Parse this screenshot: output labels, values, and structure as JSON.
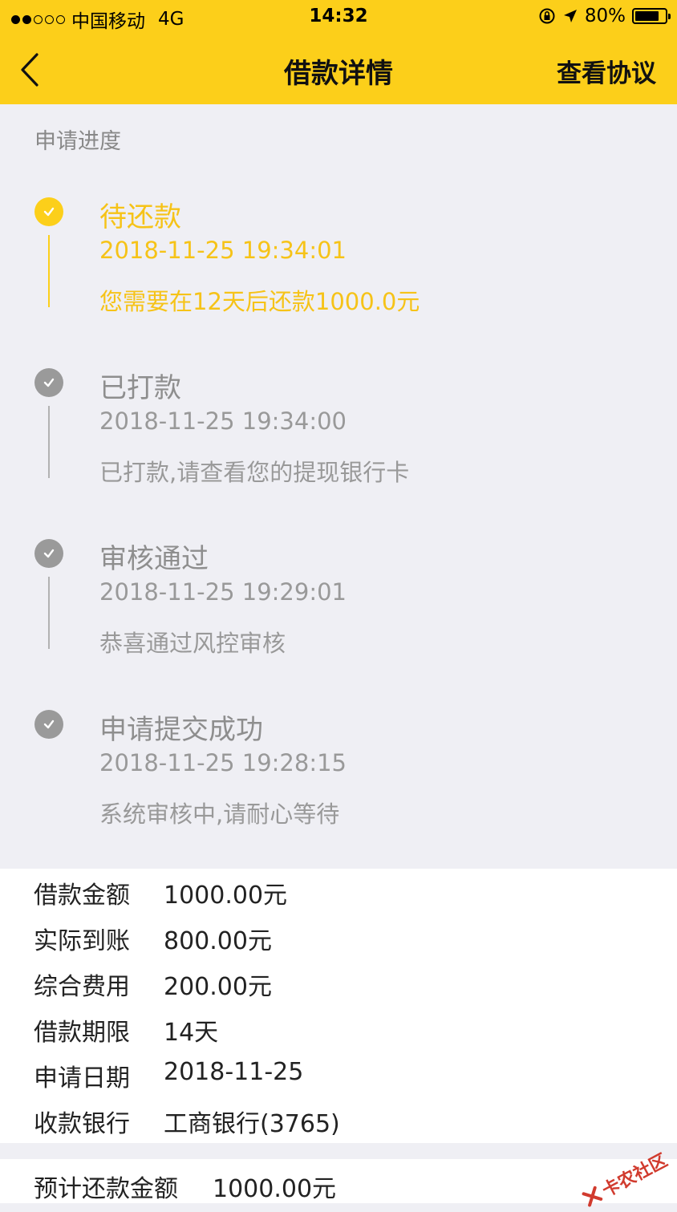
{
  "status": {
    "carrier": "中国移动",
    "network": "4G",
    "time": "14:32",
    "battery": "80%",
    "battery_level": 0.8,
    "signal_dots_filled": 2,
    "signal_dots_total": 5
  },
  "nav": {
    "title": "借款详情",
    "right_action": "查看协议",
    "back_icon": "chevron-left-icon"
  },
  "progress": {
    "label": "申请进度",
    "steps": [
      {
        "title": "待还款",
        "time": "2018-11-25 19:34:01",
        "note": "您需要在12天后还款1000.0元",
        "state": "active"
      },
      {
        "title": "已打款",
        "time": "2018-11-25 19:34:00",
        "note": "已打款,请查看您的提现银行卡",
        "state": "done"
      },
      {
        "title": "审核通过",
        "time": "2018-11-25 19:29:01",
        "note": "恭喜通过风控审核",
        "state": "done"
      },
      {
        "title": "申请提交成功",
        "time": "2018-11-25 19:28:15",
        "note": "系统审核中,请耐心等待",
        "state": "done"
      }
    ]
  },
  "details": {
    "rows": [
      {
        "key": "借款金额",
        "value": "1000.00元"
      },
      {
        "key": "实际到账",
        "value": "800.00元"
      },
      {
        "key": "综合费用",
        "value": "200.00元"
      },
      {
        "key": "借款期限",
        "value": "14天"
      },
      {
        "key": "申请日期",
        "value": "2018-11-25"
      },
      {
        "key": "收款银行",
        "value": "工商银行(3765)"
      }
    ],
    "expected_label": "预计还款金额",
    "expected_value": "1000.00元"
  },
  "watermark": "卡农社区",
  "colors": {
    "accent": "#fccf1a",
    "active_text": "#f6c318",
    "inactive": "#9a9a9a",
    "background": "#efeff4"
  }
}
